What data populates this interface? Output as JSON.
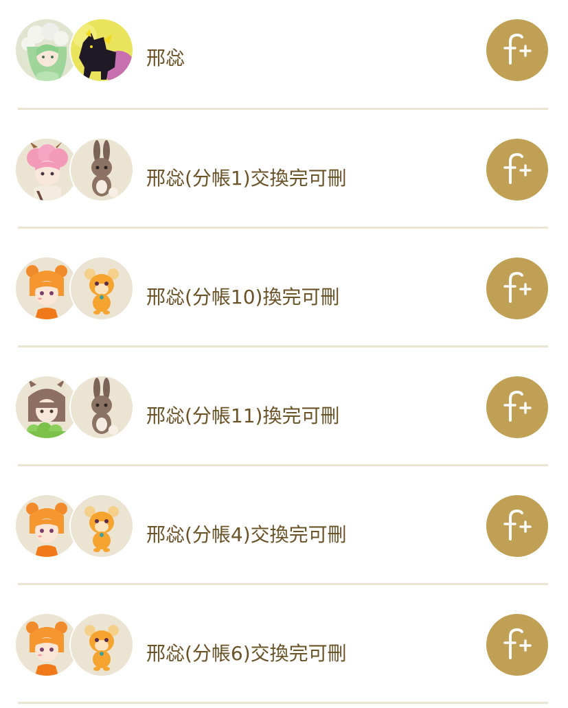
{
  "friends": [
    {
      "name": "邢惢",
      "avatar_theme": "green-white-hair-girl",
      "pet_theme": "black-yellow-wolf",
      "action_icon": "follow-plus-icon"
    },
    {
      "name": "邢惢(分帳1)交換完可刪",
      "avatar_theme": "pink-hair-horn-girl",
      "pet_theme": "brown-rabbit",
      "action_icon": "follow-plus-icon"
    },
    {
      "name": "邢惢(分帳10)換完可刪",
      "avatar_theme": "orange-bear-hat-kid",
      "pet_theme": "orange-bear-cub",
      "action_icon": "follow-plus-icon"
    },
    {
      "name": "邢惢(分帳11)換完可刪",
      "avatar_theme": "brown-hair-bunny-ear-girl",
      "pet_theme": "brown-rabbit",
      "action_icon": "follow-plus-icon"
    },
    {
      "name": "邢惢(分帳4)交換完可刪",
      "avatar_theme": "orange-bear-hat-kid",
      "pet_theme": "orange-bear-cub",
      "action_icon": "follow-plus-icon"
    },
    {
      "name": "邢惢(分帳6)交換完可刪",
      "avatar_theme": "orange-bear-hat-kid",
      "pet_theme": "orange-bear-cub",
      "action_icon": "follow-plus-icon"
    }
  ],
  "colors": {
    "accent": "#bfa054",
    "text": "#6a5227",
    "divider": "#ece4d2",
    "avatar_bg": "#ece4d2"
  }
}
